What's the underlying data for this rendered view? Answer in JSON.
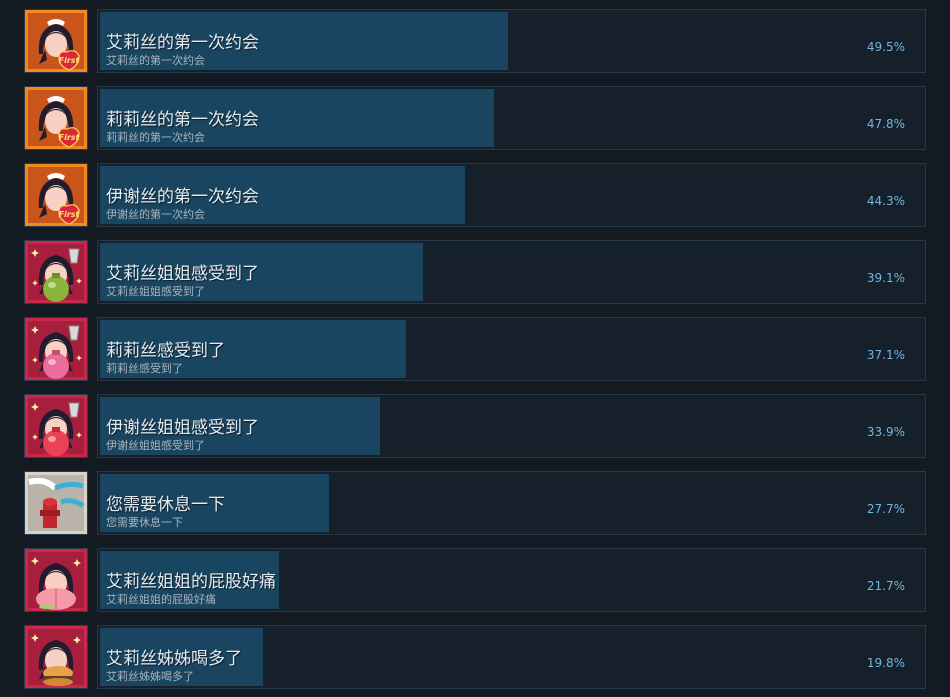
{
  "achievements": [
    {
      "title": "艾莉丝的第一次约会",
      "desc": "艾莉丝的第一次约会",
      "percent_label": "49.5%",
      "percent": 49.5,
      "icon": "first-date-heart-icon"
    },
    {
      "title": "莉莉丝的第一次约会",
      "desc": "莉莉丝的第一次约会",
      "percent_label": "47.8%",
      "percent": 47.8,
      "icon": "first-date-heart-icon"
    },
    {
      "title": "伊谢丝的第一次约会",
      "desc": "伊谢丝的第一次约会",
      "percent_label": "44.3%",
      "percent": 44.3,
      "icon": "first-date-heart-icon"
    },
    {
      "title": "艾莉丝姐姐感受到了",
      "desc": "艾莉丝姐姐感受到了",
      "percent_label": "39.1%",
      "percent": 39.1,
      "icon": "potion-green-icon"
    },
    {
      "title": "莉莉丝感受到了",
      "desc": "莉莉丝感受到了",
      "percent_label": "37.1%",
      "percent": 37.1,
      "icon": "potion-pink-icon"
    },
    {
      "title": "伊谢丝姐姐感受到了",
      "desc": "伊谢丝姐姐感受到了",
      "percent_label": "33.9%",
      "percent": 33.9,
      "icon": "potion-red-icon"
    },
    {
      "title": "您需要休息一下",
      "desc": "您需要休息一下",
      "percent_label": "27.7%",
      "percent": 27.7,
      "icon": "fire-hydrant-icon"
    },
    {
      "title": "艾莉丝姐姐的屁股好痛",
      "desc": "艾莉丝姐姐的屁股好痛",
      "percent_label": "21.7%",
      "percent": 21.7,
      "icon": "peach-icon"
    },
    {
      "title": "艾莉丝姊姊喝多了",
      "desc": "艾莉丝姊姊喝多了",
      "percent_label": "19.8%",
      "percent": 19.8,
      "icon": "burger-icon"
    }
  ],
  "colors": {
    "background": "#131a21",
    "bar_fill": "#1a4560",
    "bar_empty": "#16202b",
    "percent_text": "#72b6e0",
    "first_frame": "#f08a1e",
    "potion_frame": "#c8294a"
  }
}
